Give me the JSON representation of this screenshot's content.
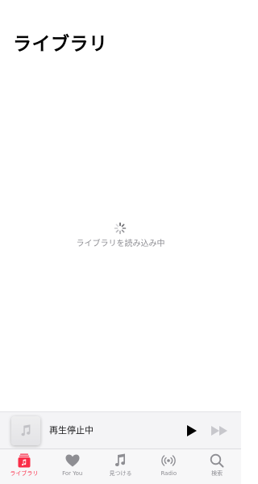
{
  "page": {
    "title": "ライブラリ",
    "loading_text": "ライブラリを読み込み中"
  },
  "mini_player": {
    "status": "再生停止中",
    "artwork_icon": "music-note-icon",
    "play_icon": "play-icon",
    "forward_icon": "fast-forward-icon"
  },
  "tabs": [
    {
      "label": "ライブラリ",
      "icon": "library-icon",
      "active": true
    },
    {
      "label": "For You",
      "icon": "heart-icon",
      "active": false
    },
    {
      "label": "見つける",
      "icon": "music-note-icon",
      "active": false
    },
    {
      "label": "Radio",
      "icon": "radio-icon",
      "active": false
    },
    {
      "label": "検索",
      "icon": "search-icon",
      "active": false
    }
  ],
  "colors": {
    "accent": "#fa2d48",
    "inactive": "#8e8e93",
    "disabled": "#c7c7cc"
  }
}
